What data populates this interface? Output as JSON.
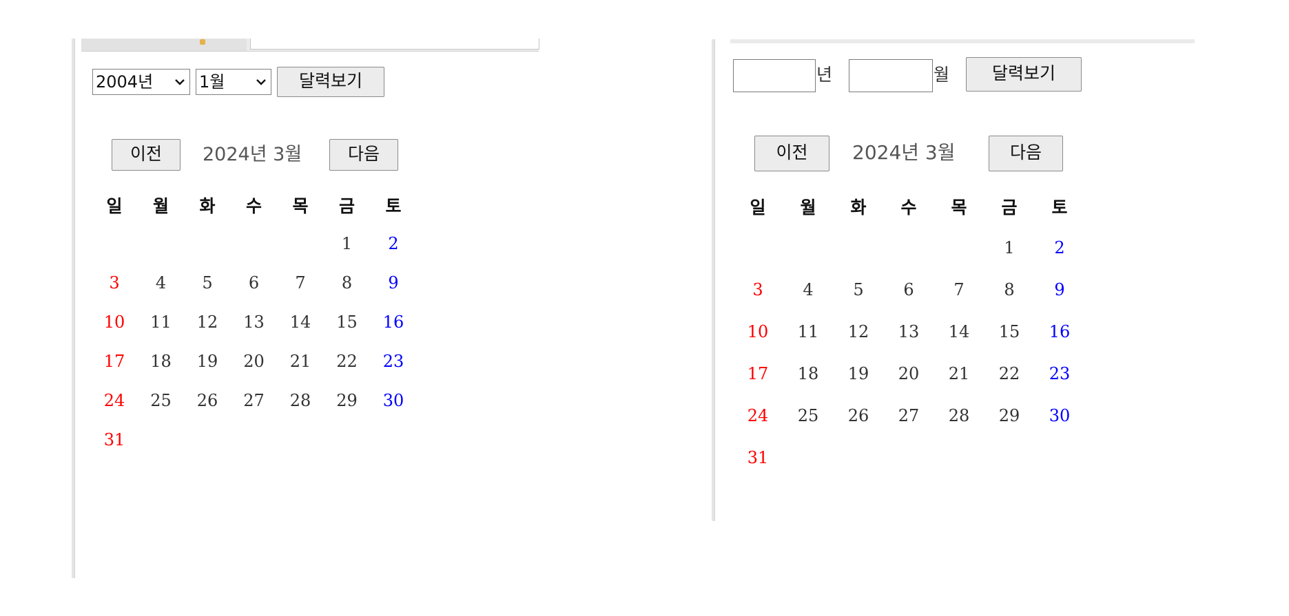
{
  "left_panel": {
    "year_select": {
      "selected": "2004년"
    },
    "month_select": {
      "selected": "1월"
    },
    "view_button": "달력보기",
    "prev_button": "이전",
    "next_button": "다음",
    "month_label": "2024년 3월",
    "weekdays": [
      "일",
      "월",
      "화",
      "수",
      "목",
      "금",
      "토"
    ],
    "days": [
      [
        "",
        "",
        "",
        "",
        "",
        "1",
        "2"
      ],
      [
        "3",
        "4",
        "5",
        "6",
        "7",
        "8",
        "9"
      ],
      [
        "10",
        "11",
        "12",
        "13",
        "14",
        "15",
        "16"
      ],
      [
        "17",
        "18",
        "19",
        "20",
        "21",
        "22",
        "23"
      ],
      [
        "24",
        "25",
        "26",
        "27",
        "28",
        "29",
        "30"
      ],
      [
        "31",
        "",
        "",
        "",
        "",
        "",
        ""
      ]
    ]
  },
  "right_panel": {
    "year_input": {
      "value": "",
      "unit": "년"
    },
    "month_input": {
      "value": "",
      "unit": "월"
    },
    "view_button": "달력보기",
    "prev_button": "이전",
    "next_button": "다음",
    "month_label": "2024년 3월",
    "weekdays": [
      "일",
      "월",
      "화",
      "수",
      "목",
      "금",
      "토"
    ],
    "days": [
      [
        "",
        "",
        "",
        "",
        "",
        "1",
        "2"
      ],
      [
        "3",
        "4",
        "5",
        "6",
        "7",
        "8",
        "9"
      ],
      [
        "10",
        "11",
        "12",
        "13",
        "14",
        "15",
        "16"
      ],
      [
        "17",
        "18",
        "19",
        "20",
        "21",
        "22",
        "23"
      ],
      [
        "24",
        "25",
        "26",
        "27",
        "28",
        "29",
        "30"
      ],
      [
        "31",
        "",
        "",
        "",
        "",
        "",
        ""
      ]
    ]
  },
  "colors": {
    "sunday": "#ff0000",
    "saturday": "#0000ff",
    "weekday": "#333333"
  }
}
